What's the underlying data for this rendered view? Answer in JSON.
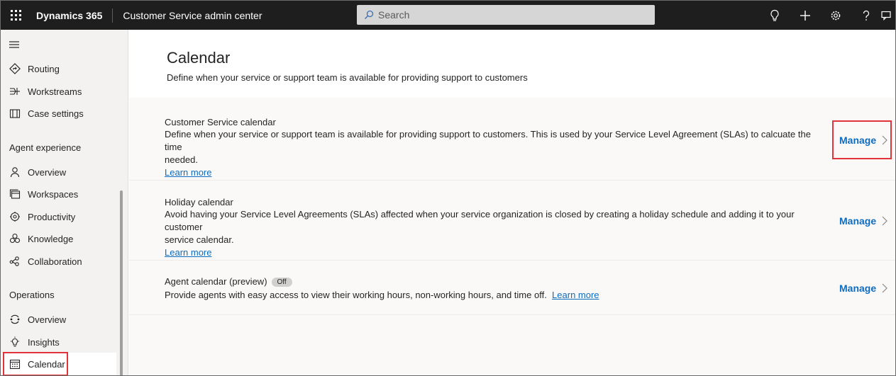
{
  "topbar": {
    "brand": "Dynamics 365",
    "app_name": "Customer Service admin center",
    "search_placeholder": "Search"
  },
  "sidebar": {
    "items_top": [
      {
        "label": "Routing",
        "icon": "routing-icon"
      },
      {
        "label": "Workstreams",
        "icon": "workstreams-icon"
      },
      {
        "label": "Case settings",
        "icon": "case-settings-icon"
      }
    ],
    "section_agent": "Agent experience",
    "items_agent": [
      {
        "label": "Overview",
        "icon": "person-icon"
      },
      {
        "label": "Workspaces",
        "icon": "workspaces-icon"
      },
      {
        "label": "Productivity",
        "icon": "productivity-icon"
      },
      {
        "label": "Knowledge",
        "icon": "knowledge-icon"
      },
      {
        "label": "Collaboration",
        "icon": "collaboration-icon"
      }
    ],
    "section_operations": "Operations",
    "items_operations": [
      {
        "label": "Overview",
        "icon": "overview-icon"
      },
      {
        "label": "Insights",
        "icon": "lightbulb-icon"
      },
      {
        "label": "Calendar",
        "icon": "calendar-icon",
        "active": true
      }
    ]
  },
  "main": {
    "title": "Calendar",
    "subtitle": "Define when your service or support team is available for providing support to customers",
    "cards": [
      {
        "title": "Customer Service calendar",
        "desc_line1": "Define when your service or support team is available for providing support to customers. This is used by your Service Level Agreement (SLAs) to calcuate the time",
        "desc_line2": "needed.",
        "link": "Learn more",
        "action": "Manage"
      },
      {
        "title": "Holiday calendar",
        "desc_line1": "Avoid having your Service Level Agreements (SLAs) affected when your service organization is closed by creating a holiday schedule and adding it to your customer",
        "desc_line2": "service calendar.",
        "link": "Learn more",
        "action": "Manage"
      },
      {
        "title": "Agent calendar (preview)",
        "badge": "Off",
        "desc_line1": "Provide agents with easy access to view their working hours, non-working hours, and time off.",
        "link": "Learn more",
        "action": "Manage"
      }
    ]
  },
  "colors": {
    "topbar_bg": "#1e1e1e",
    "link": "#0f6cbd",
    "highlight": "#e0333b",
    "sidebar_bg": "#f3f2f1"
  }
}
